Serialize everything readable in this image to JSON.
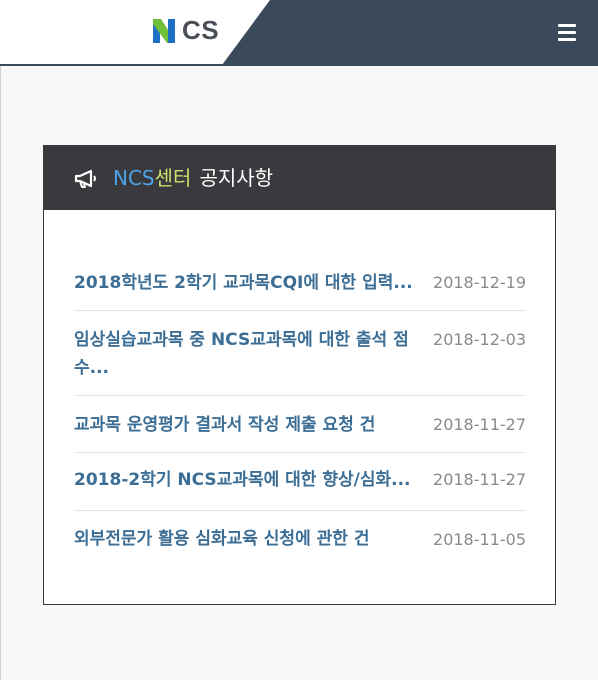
{
  "header": {
    "logo_text": "CS",
    "logo_letter": "N",
    "brand_colors": {
      "blue": "#1f6fc7",
      "green": "#6fbf3a",
      "dark": "#3b4a5b"
    },
    "menu_icon": "hamburger-icon"
  },
  "notice": {
    "icon": "megaphone-icon",
    "title_part1": "NCS",
    "title_part2": "센터",
    "title_part3": "공지사항",
    "items": [
      {
        "title": "2018학년도 2학기 교과목CQI에 대한 입력...",
        "date": "2018-12-19"
      },
      {
        "title": "임상실습교과목 중 NCS교과목에 대한 출석 점수...",
        "date": "2018-12-03"
      },
      {
        "title": "교과목 운영평가 결과서 작성 제출 요청 건",
        "date": "2018-11-27"
      },
      {
        "title": "2018-2학기 NCS교과목에 대한 향상/심화...",
        "date": "2018-11-27"
      },
      {
        "title": "외부전문가 활용 심화교육 신청에 관한 건",
        "date": "2018-11-05"
      }
    ]
  }
}
